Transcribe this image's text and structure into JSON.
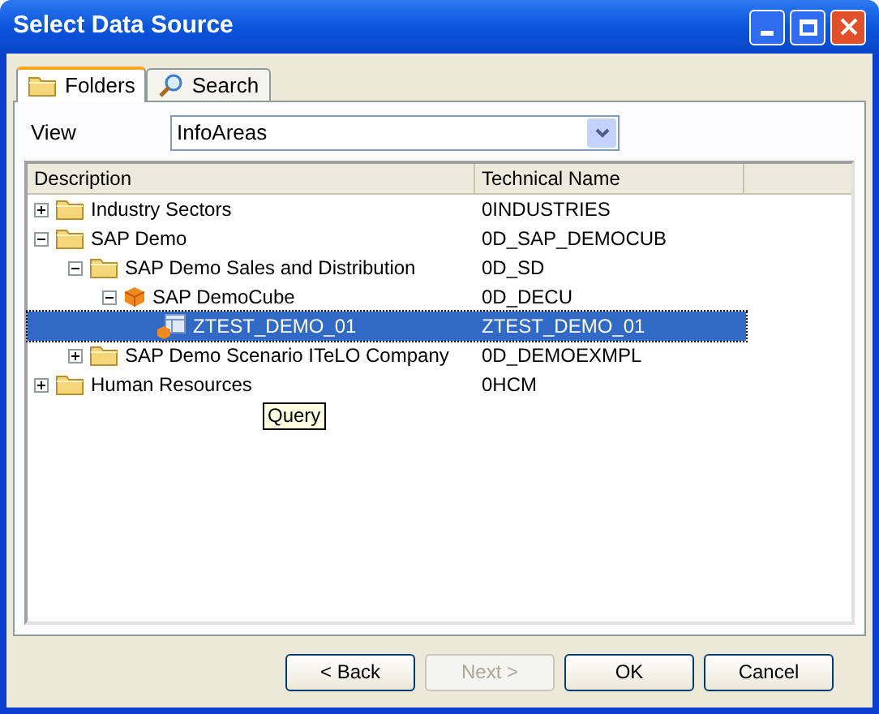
{
  "window": {
    "title": "Select Data Source"
  },
  "tabs": [
    {
      "label": "Folders",
      "selected": true,
      "kind": "folder"
    },
    {
      "label": "Search",
      "selected": false,
      "kind": "search"
    }
  ],
  "view": {
    "label": "View",
    "value": "InfoAreas"
  },
  "table": {
    "columns": [
      "Description",
      "Technical Name"
    ],
    "rows": [
      {
        "kind": "folder",
        "description": "Industry Sectors",
        "technical_name": "0INDUSTRIES",
        "expanded": false,
        "selected": false
      },
      {
        "kind": "folder",
        "description": "SAP Demo",
        "technical_name": "0D_SAP_DEMOCUB",
        "expanded": true,
        "selected": false,
        "children": [
          {
            "kind": "folder",
            "description": "SAP Demo Sales and Distribution",
            "technical_name": "0D_SD",
            "expanded": true,
            "selected": false,
            "children": [
              {
                "kind": "cube",
                "description": "SAP DemoCube",
                "technical_name": "0D_DECU",
                "expanded": true,
                "selected": false,
                "children": [
                  {
                    "kind": "query",
                    "description": "ZTEST_DEMO_01",
                    "technical_name": "ZTEST_DEMO_01",
                    "selected": true
                  }
                ]
              }
            ]
          },
          {
            "kind": "folder",
            "description": "SAP Demo Scenario ITeLO Company",
            "technical_name": "0D_DEMOEXMPL",
            "expanded": false,
            "selected": false
          }
        ]
      },
      {
        "kind": "folder",
        "description": "Human Resources",
        "technical_name": "0HCM",
        "expanded": false,
        "selected": false
      }
    ]
  },
  "tooltip": "Query",
  "buttons": [
    {
      "label": "< Back",
      "disabled": false
    },
    {
      "label": "Next >",
      "disabled": true
    },
    {
      "label": "OK",
      "disabled": false
    },
    {
      "label": "Cancel",
      "disabled": false
    }
  ]
}
